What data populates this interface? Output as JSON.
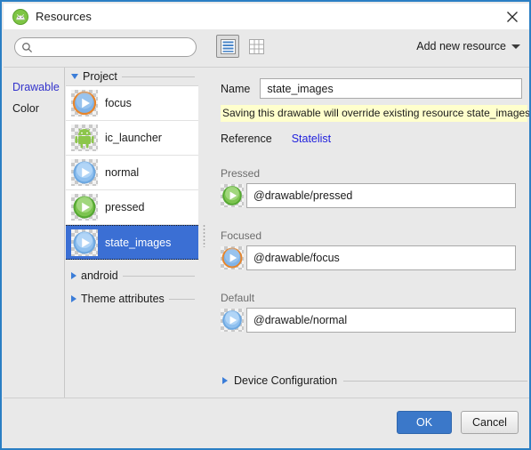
{
  "window": {
    "title": "Resources",
    "app_icon": "android-studio-icon",
    "close_label": "×",
    "accent_color": "#2b7fc4"
  },
  "toolbar": {
    "search": {
      "value": "",
      "placeholder": "",
      "icon": "search-icon"
    },
    "view_list_icon": "list-view-icon",
    "view_grid_icon": "grid-view-icon",
    "add_new_resource": "Add new resource"
  },
  "categories": {
    "items": [
      {
        "label": "Drawable",
        "selected": true
      },
      {
        "label": "Color",
        "selected": false
      }
    ]
  },
  "tree": {
    "groups": [
      {
        "label": "Project",
        "expanded": true
      },
      {
        "label": "android",
        "expanded": false
      },
      {
        "label": "Theme attributes",
        "expanded": false
      }
    ],
    "items": [
      {
        "label": "focus",
        "icon": "play-focus-icon",
        "selected": false
      },
      {
        "label": "ic_launcher",
        "icon": "android-robot-icon",
        "selected": false
      },
      {
        "label": "normal",
        "icon": "play-normal-icon",
        "selected": false
      },
      {
        "label": "pressed",
        "icon": "play-pressed-icon",
        "selected": false
      },
      {
        "label": "state_images",
        "icon": "play-normal-icon",
        "selected": true
      }
    ]
  },
  "editor": {
    "name_label": "Name",
    "name_value": "state_images",
    "warning": "Saving this drawable will override existing resource state_images.",
    "warning_bg": "#ffffcc",
    "tabs": [
      {
        "label": "Reference",
        "active": false
      },
      {
        "label": "Statelist",
        "active": true
      }
    ],
    "states": [
      {
        "label": "Pressed",
        "value": "@drawable/pressed",
        "icon": "play-pressed-icon"
      },
      {
        "label": "Focused",
        "value": "@drawable/focus",
        "icon": "play-focus-icon"
      },
      {
        "label": "Default",
        "value": "@drawable/normal",
        "icon": "play-normal-icon"
      }
    ],
    "device_configuration": {
      "label": "Device Configuration",
      "expanded": false
    }
  },
  "footer": {
    "ok_label": "OK",
    "cancel_label": "Cancel"
  }
}
